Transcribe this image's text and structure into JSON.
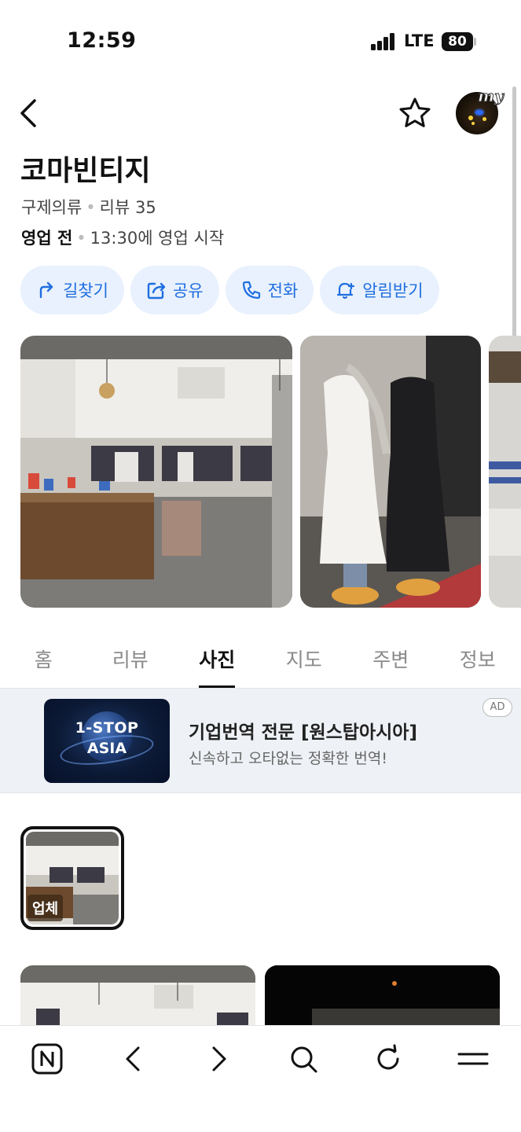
{
  "status_bar": {
    "time": "12:59",
    "network": "LTE",
    "battery": "80"
  },
  "header": {
    "avatar_badge": "my"
  },
  "place": {
    "name": "코마빈티지",
    "category": "구제의류",
    "reviews": "리뷰 35",
    "status": "영업 전",
    "hours_note": "13:30에 영업 시작"
  },
  "actions": [
    {
      "label": "길찾기",
      "icon": "directions-icon"
    },
    {
      "label": "공유",
      "icon": "share-icon"
    },
    {
      "label": "전화",
      "icon": "phone-icon"
    },
    {
      "label": "알림받기",
      "icon": "bell-plus-icon"
    }
  ],
  "tabs": [
    {
      "label": "홈",
      "active": false
    },
    {
      "label": "리뷰",
      "active": false
    },
    {
      "label": "사진",
      "active": true
    },
    {
      "label": "지도",
      "active": false
    },
    {
      "label": "주변",
      "active": false
    },
    {
      "label": "정보",
      "active": false
    }
  ],
  "ad": {
    "logo_line1": "1-STOP",
    "logo_line2": "ASIA",
    "title": "기업번역 전문 [원스탑아시아]",
    "description": "신속하고 오타없는 정확한 번역!",
    "badge": "AD"
  },
  "photo_category": {
    "label": "업체"
  },
  "colors": {
    "accent": "#1f6ee0",
    "button_bg": "#e8f1fd"
  }
}
